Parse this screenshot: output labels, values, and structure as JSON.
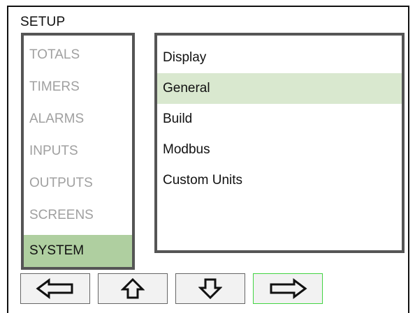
{
  "header": {
    "title": "SETUP"
  },
  "menu": {
    "categories": [
      {
        "label": "TOTALS"
      },
      {
        "label": "TIMERS"
      },
      {
        "label": "ALARMS"
      },
      {
        "label": "INPUTS"
      },
      {
        "label": "OUTPUTS"
      },
      {
        "label": "SCREENS"
      },
      {
        "label": "SYSTEM",
        "selected": true
      }
    ],
    "submenu": [
      {
        "label": "Display"
      },
      {
        "label": "General",
        "selected": true
      },
      {
        "label": "Build"
      },
      {
        "label": "Modbus"
      },
      {
        "label": "Custom Units"
      }
    ]
  },
  "nav_buttons": [
    {
      "icon": "arrow-left-icon"
    },
    {
      "icon": "arrow-up-icon"
    },
    {
      "icon": "arrow-down-icon"
    },
    {
      "icon": "arrow-right-icon",
      "focused": true
    }
  ],
  "colors": {
    "category_selected": "#afcfa0",
    "submenu_selected": "#d9e8cf",
    "focus_border": "#43d443",
    "inactive_text": "#a0a0a0"
  }
}
